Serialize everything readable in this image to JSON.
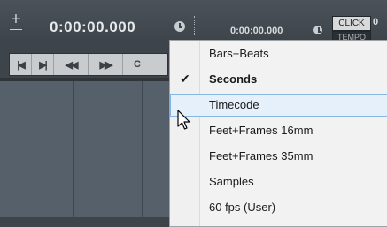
{
  "transport": {
    "primary_time": "0:00:00.000",
    "secondary_time": "0:00:00.000",
    "click_label": "CLICK",
    "click_value": "0",
    "tempo_label": "TEMPO"
  },
  "strip": {
    "buttons": [
      {
        "icon": "go-to-start-icon",
        "glyph": "|◀"
      },
      {
        "icon": "go-to-end-icon",
        "glyph": "▶|"
      },
      {
        "icon": "rewind-icon",
        "glyph": "◀◀"
      },
      {
        "icon": "fast-forward-icon",
        "glyph": "▶▶"
      },
      {
        "icon": "cycle-icon",
        "glyph": "C"
      }
    ]
  },
  "menu": {
    "items": [
      {
        "label": "Bars+Beats",
        "checked": false,
        "bold": false,
        "hover": false
      },
      {
        "label": "Seconds",
        "checked": true,
        "bold": true,
        "hover": false
      },
      {
        "label": "Timecode",
        "checked": false,
        "bold": false,
        "hover": true
      },
      {
        "label": "Feet+Frames 16mm",
        "checked": false,
        "bold": false,
        "hover": false
      },
      {
        "label": "Feet+Frames 35mm",
        "checked": false,
        "bold": false,
        "hover": false
      },
      {
        "label": "Samples",
        "checked": false,
        "bold": false,
        "hover": false
      },
      {
        "label": "60 fps (User)",
        "checked": false,
        "bold": false,
        "hover": false
      }
    ],
    "check_glyph": "✔",
    "hover_color": "#e5f0fa"
  }
}
